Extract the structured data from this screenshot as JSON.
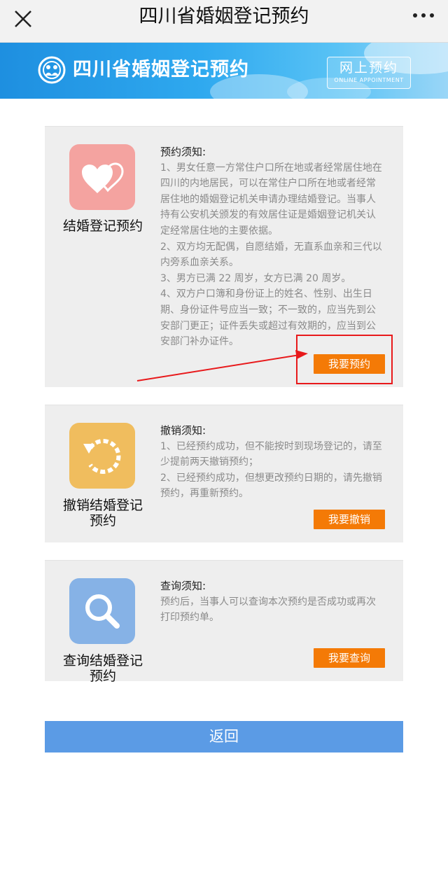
{
  "topbar": {
    "title": "四川省婚姻登记预约",
    "close_icon": "close-icon",
    "more_icon": "more-icon"
  },
  "banner": {
    "title": "四川省婚姻登记预约",
    "online_cn": "网上预约",
    "online_en": "ONLINE APPOINTMENT",
    "logo_icon": "emblem-icon"
  },
  "cards": [
    {
      "label": "结婚登记预约",
      "icon": "hearts-icon",
      "color": "#f4a3a0",
      "notice_title": "预约须知:",
      "lines": [
        "1、男女任意一方常住户口所在地或者经常居住地在",
        "四川的内地居民，可以在常住户口所在地或者经常",
        "居住地的婚姻登记机关申请办理结婚登记。当事人",
        "持有公安机关颁发的有效居住证是婚姻登记机关认",
        "定经常居住地的主要依据。",
        "2、双方均无配偶，自愿结婚，无直系血亲和三代以",
        "内旁系血亲关系。",
        "3、男方已满 22 周岁，女方已满 20 周岁。",
        "4、双方户口簿和身份证上的姓名、性别、出生日",
        "期、身份证件号应当一致；不一致的，应当先到公",
        "安部门更正；证件丢失或超过有效期的，应当到公",
        "安部门补办证件。"
      ],
      "button": "我要预约"
    },
    {
      "label_line1": "撤销结婚登记",
      "label_line2": "预约",
      "icon": "undo-icon",
      "color": "#f0bd5e",
      "notice_title": "撤销须知:",
      "lines": [
        "1、已经预约成功，但不能按时到现场登记的，请至",
        "少提前两天撤销预约；",
        "2、已经预约成功，但想更改预约日期的，请先撤销",
        "预约，再重新预约。"
      ],
      "button": "我要撤销"
    },
    {
      "label_line1": "查询结婚登记",
      "label_line2": "预约",
      "icon": "search-icon",
      "color": "#86b2e6",
      "notice_title": "查询须知:",
      "lines": [
        "预约后，当事人可以查询本次预约是否成功或再次",
        "打印预约单。"
      ],
      "button": "我要查询"
    }
  ],
  "return_button": "返回",
  "annotation_color": "#e8191b"
}
